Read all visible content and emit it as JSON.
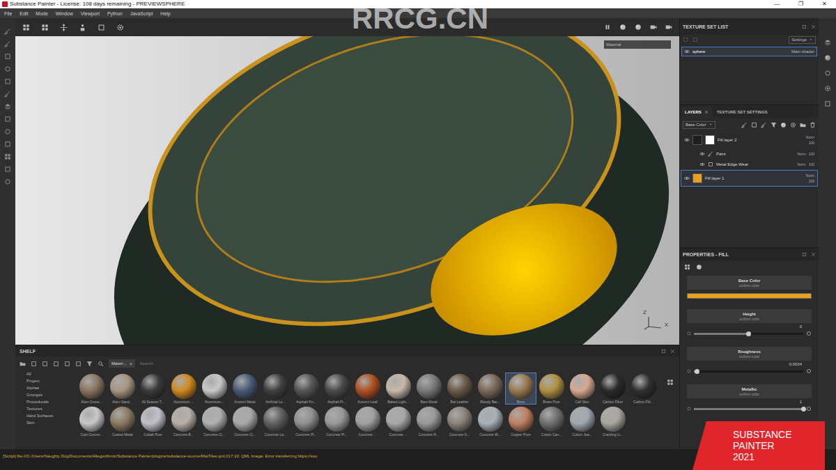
{
  "window": {
    "title": "Substance Painter - License: 108 days remaining - PREVIEWSPHERE",
    "controls": [
      "—",
      "❐",
      "✕"
    ]
  },
  "menu": [
    "File",
    "Edit",
    "Mode",
    "Window",
    "Viewport",
    "Python",
    "JavaScript",
    "Help"
  ],
  "watermark": "RRCG.CN",
  "viewport": {
    "mode": "Material",
    "axis": [
      "Z",
      "X"
    ]
  },
  "texture_set_list": {
    "title": "TEXTURE SET LIST",
    "settings": "Settings",
    "sets": [
      {
        "name": "sphere",
        "shader": "Main shader",
        "selected": true
      }
    ]
  },
  "layers": {
    "tabs": [
      {
        "label": "LAYERS",
        "selected": true
      },
      {
        "label": "TEXTURE SET SETTINGS",
        "selected": false
      }
    ],
    "channel": "Base Color",
    "items": [
      {
        "kind": "fill",
        "name": "Fill layer 2",
        "blend": "Norm",
        "opacity": "100",
        "visible": true,
        "selected": false,
        "color": "#1e1e1e",
        "mask": "#ffffff"
      },
      {
        "kind": "paint",
        "name": "Paint",
        "blend": "Norm",
        "opacity": "100",
        "visible": true,
        "selected": false
      },
      {
        "kind": "generator",
        "name": "Metal Edge Wear",
        "blend": "Norm",
        "opacity": "100",
        "visible": true,
        "selected": false
      },
      {
        "kind": "fill",
        "name": "Fill layer 1",
        "blend": "Norm",
        "opacity": "100",
        "visible": true,
        "selected": true,
        "color": "#e8a020"
      }
    ]
  },
  "properties": {
    "title": "PROPERTIES - FILL",
    "items": [
      {
        "kind": "color",
        "label": "Base Color",
        "source": "uniform color",
        "color": "#e9a21f"
      },
      {
        "kind": "slider",
        "label": "Height",
        "source": "uniform color",
        "value": "0",
        "level": 0.5
      },
      {
        "kind": "slider",
        "label": "Roughness",
        "source": "uniform color",
        "value": "0.0034",
        "level": 0.03
      },
      {
        "kind": "slider",
        "label": "Metallic",
        "source": "uniform color",
        "value": "1",
        "level": 1
      }
    ]
  },
  "shelf": {
    "title": "SHELF",
    "filter_tag": "Materi...",
    "filter_close": "×",
    "search_placeholder": "Search...",
    "categories": [
      {
        "label": "All",
        "selected": false
      },
      {
        "label": "Project",
        "selected": false
      },
      {
        "label": "Alphas",
        "selected": false
      },
      {
        "label": "Grunges",
        "selected": false
      },
      {
        "label": "Procedurals",
        "selected": false
      },
      {
        "label": "Textures",
        "selected": false
      },
      {
        "label": "Hard Surfaces",
        "selected": false
      },
      {
        "label": "Skin",
        "selected": false
      }
    ],
    "material_rows": [
      [
        {
          "name": "Alien Grove...",
          "color": "#8a7560",
          "selected": false
        },
        {
          "name": "Alien Sand...",
          "color": "#a89580",
          "selected": false
        },
        {
          "name": "All Season T...",
          "color": "#3a3a3a",
          "selected": false
        },
        {
          "name": "Aluminium ...",
          "color": "#d08a20",
          "selected": false
        },
        {
          "name": "Aluminium...",
          "color": "#c8c8c8",
          "selected": false
        },
        {
          "name": "Ancient Metal",
          "color": "#4a5a78",
          "selected": false
        },
        {
          "name": "Artificial Le...",
          "color": "#404040",
          "selected": false
        },
        {
          "name": "Asphalt Fin...",
          "color": "#555555",
          "selected": false
        },
        {
          "name": "Asphalt Fr...",
          "color": "#4a4a4a",
          "selected": false
        },
        {
          "name": "Autumn Leaf",
          "color": "#b05020",
          "selected": false
        },
        {
          "name": "Baked Light...",
          "color": "#c8b8a8",
          "selected": false
        },
        {
          "name": "Bare Metal",
          "color": "#7a7a7a",
          "selected": false
        },
        {
          "name": "Bat Leather",
          "color": "#6a5a48",
          "selected": false
        },
        {
          "name": "Bloody Bat...",
          "color": "#7a6858",
          "selected": false
        },
        {
          "name": "Bone",
          "color": "#9a7a50",
          "selected": true
        },
        {
          "name": "Brass Pure",
          "color": "#b09040",
          "selected": false
        },
        {
          "name": "Calf Skin",
          "color": "#d8a890",
          "selected": false
        },
        {
          "name": "Carbon Fiber",
          "color": "#2a2a2a",
          "selected": false
        },
        {
          "name": "Carbon Fib...",
          "color": "#303030",
          "selected": false
        }
      ],
      [
        {
          "name": "Cast Concre...",
          "color": "#c8c8c8",
          "selected": false
        },
        {
          "name": "Coated Metal",
          "color": "#8a7a60",
          "selected": false
        },
        {
          "name": "Cobalt Pure",
          "color": "#c0c0c8",
          "selected": false
        },
        {
          "name": "Concrete B...",
          "color": "#b8b0a8",
          "selected": false
        },
        {
          "name": "Concrete Cl...",
          "color": "#b0b0b0",
          "selected": false
        },
        {
          "name": "Concrete Cl...",
          "color": "#a8a8a8",
          "selected": false
        },
        {
          "name": "Concrete La...",
          "color": "#606060",
          "selected": false
        },
        {
          "name": "Concrete Pl...",
          "color": "#909090",
          "selected": false
        },
        {
          "name": "Concrete Pl...",
          "color": "#989898",
          "selected": false
        },
        {
          "name": "Concrete ...",
          "color": "#a0a0a0",
          "selected": false
        },
        {
          "name": "Concrete ...",
          "color": "#a8a8a8",
          "selected": false
        },
        {
          "name": "Concrete R...",
          "color": "#989898",
          "selected": false
        },
        {
          "name": "Concrete S...",
          "color": "#8a8278",
          "selected": false
        },
        {
          "name": "Concrete W...",
          "color": "#a8b0b8",
          "selected": false
        },
        {
          "name": "Copper Pure",
          "color": "#c08060",
          "selected": false
        },
        {
          "name": "Cotton Can...",
          "color": "#707070",
          "selected": false
        },
        {
          "name": "Cotton Jea...",
          "color": "#a0a8b0",
          "selected": false
        },
        {
          "name": "Cracking Li...",
          "color": "#a8a8a0",
          "selected": false
        }
      ]
    ]
  },
  "status_bar": "[Script] file:///C:/Users/Naughty Dog/Documents/Allegorithmic/Substance Painter/plugins/substance-source/MatTiles.qml:217:10: QML Image: Error transferring https://sou",
  "badge": [
    "SUBSTANCE",
    "PAINTER",
    "2021"
  ]
}
